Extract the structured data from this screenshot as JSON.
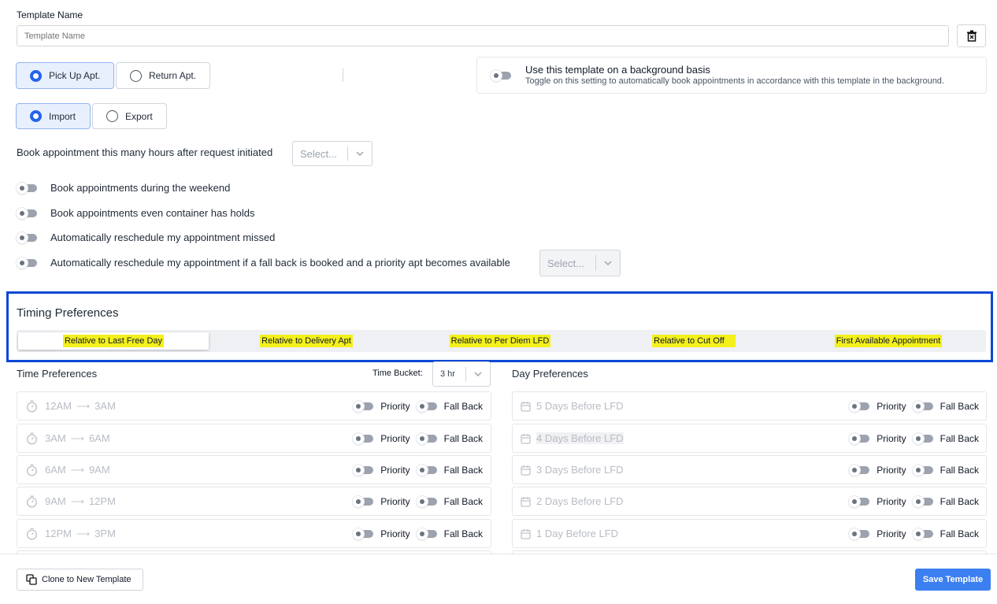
{
  "template": {
    "label": "Template Name",
    "placeholder": "Template Name"
  },
  "icons": {
    "delete": "trash-icon",
    "chevron": "chevron-down-icon",
    "stopwatch": "stopwatch-icon",
    "calendar": "calendar-icon",
    "arrow": "arrow-right-icon",
    "copy": "copy-icon"
  },
  "apt_type": {
    "options": [
      {
        "label": "Pick Up Apt.",
        "selected": true
      },
      {
        "label": "Return Apt.",
        "selected": false
      }
    ]
  },
  "direction": {
    "options": [
      {
        "label": "Import",
        "selected": true
      },
      {
        "label": "Export",
        "selected": false
      }
    ]
  },
  "background": {
    "title": "Use this template on a background basis",
    "description": "Toggle on this setting to automatically book appointments in accordance with this template in the background.",
    "enabled": false
  },
  "book_hours": {
    "label": "Book appointment this many hours after request initiated",
    "placeholder": "Select..."
  },
  "options": [
    {
      "label": "Book appointments during the weekend",
      "enabled": false
    },
    {
      "label": "Book appointments even container has holds",
      "enabled": false
    },
    {
      "label": "Automatically reschedule my appointment missed",
      "enabled": false
    },
    {
      "label": "Automatically reschedule my appointment if a fall back is booked and a priority apt becomes available",
      "enabled": false,
      "select_placeholder": "Select..."
    }
  ],
  "timing": {
    "title": "Timing Preferences",
    "tabs": [
      {
        "label": "Relative to Last Free Day",
        "active": true
      },
      {
        "label": "Relative to Delivery Apt",
        "active": false
      },
      {
        "label": "Relative to Per Diem LFD",
        "active": false
      },
      {
        "label": "Relative to Cut Off",
        "active": false
      },
      {
        "label": "First Available Appointment",
        "active": false
      }
    ]
  },
  "time_prefs": {
    "title": "Time Preferences",
    "bucket_label": "Time Bucket:",
    "bucket_value": "3 hr",
    "priority_label": "Priority",
    "fallback_label": "Fall Back",
    "rows": [
      {
        "from": "12AM",
        "to": "3AM"
      },
      {
        "from": "3AM",
        "to": "6AM"
      },
      {
        "from": "6AM",
        "to": "9AM"
      },
      {
        "from": "9AM",
        "to": "12PM"
      },
      {
        "from": "12PM",
        "to": "3PM"
      }
    ]
  },
  "day_prefs": {
    "title": "Day Preferences",
    "priority_label": "Priority",
    "fallback_label": "Fall Back",
    "rows": [
      {
        "label": "5 Days Before LFD"
      },
      {
        "label": "4 Days Before LFD"
      },
      {
        "label": "3 Days Before LFD"
      },
      {
        "label": "2 Days Before LFD"
      },
      {
        "label": "1 Day Before LFD"
      }
    ]
  },
  "footer": {
    "clone_label": "Clone to New Template",
    "save_label": "Save Template"
  },
  "colors": {
    "accent": "#2563eb",
    "highlight_box": "#0a47d6",
    "tab_highlight": "#f3f01c",
    "save_button": "#3b7ff0"
  }
}
